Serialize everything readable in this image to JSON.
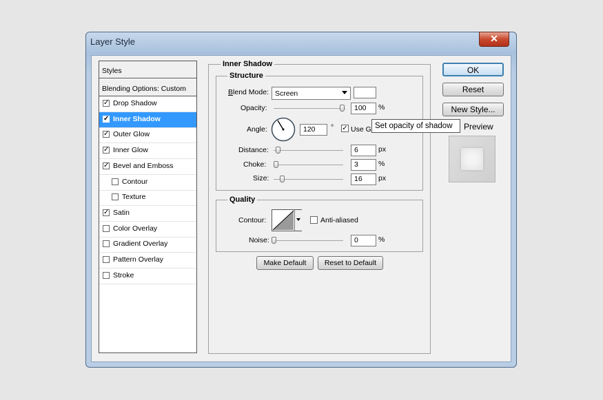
{
  "window": {
    "title": "Layer Style",
    "close_glyph": "✕"
  },
  "styles_list": {
    "header": "Styles",
    "blending": "Blending Options: Custom",
    "items": [
      {
        "label": "Drop Shadow",
        "checked": true
      },
      {
        "label": "Inner Shadow",
        "checked": true,
        "selected": true
      },
      {
        "label": "Outer Glow",
        "checked": true
      },
      {
        "label": "Inner Glow",
        "checked": true
      },
      {
        "label": "Bevel and Emboss",
        "checked": true
      },
      {
        "label": "Contour",
        "checked": false,
        "indent": true
      },
      {
        "label": "Texture",
        "checked": false,
        "indent": true
      },
      {
        "label": "Satin",
        "checked": true
      },
      {
        "label": "Color Overlay",
        "checked": false
      },
      {
        "label": "Gradient Overlay",
        "checked": false
      },
      {
        "label": "Pattern Overlay",
        "checked": false
      },
      {
        "label": "Stroke",
        "checked": false
      }
    ]
  },
  "panel": {
    "title": "Inner Shadow",
    "structure": {
      "legend": "Structure",
      "blend_mode_label": "Blend Mode:",
      "blend_mode_value": "Screen",
      "opacity_label": "Opacity:",
      "opacity_value": "100",
      "opacity_unit": "%",
      "opacity_fraction": 1.0,
      "angle_label": "Angle:",
      "angle_value": "120",
      "angle_unit": "°",
      "use_global_label": "Use Gl",
      "use_global_checked": true,
      "distance_label": "Distance:",
      "distance_value": "6",
      "distance_unit": "px",
      "choke_label": "Choke:",
      "choke_value": "3",
      "choke_unit": "%",
      "size_label": "Size:",
      "size_value": "16",
      "size_unit": "px"
    },
    "quality": {
      "legend": "Quality",
      "contour_label": "Contour:",
      "anti_aliased_label": "Anti-aliased",
      "anti_aliased_checked": false,
      "noise_label": "Noise:",
      "noise_value": "0",
      "noise_unit": "%"
    },
    "make_default": "Make Default",
    "reset_to_default": "Reset to Default"
  },
  "tooltip": "Set opacity of shadow",
  "buttons": {
    "ok": "OK",
    "reset": "Reset",
    "new_style": "New Style...",
    "preview": "Preview",
    "preview_checked": true
  }
}
